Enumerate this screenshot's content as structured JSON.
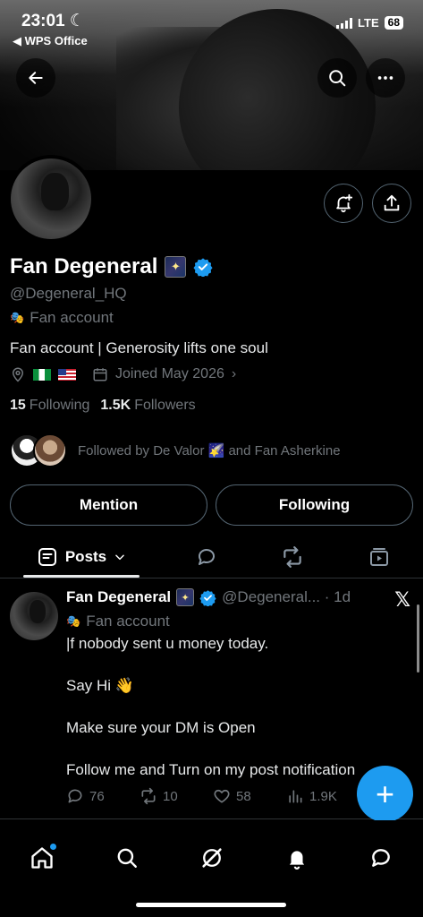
{
  "status": {
    "time": "23:01",
    "back_app": "◀ WPS Office",
    "network": "LTE",
    "battery": "68"
  },
  "profile": {
    "name": "Fan Degeneral",
    "handle": "@Degeneral_HQ",
    "label": "Fan account",
    "bio": "Fan account | Generosity lifts one soul",
    "joined": "Joined May 2026",
    "following_count": "15",
    "following_label": "Following",
    "followers_count": "1.5K",
    "followers_label": "Followers",
    "followed_by": "Followed by De Valor 🌠 and Fan Asherkine"
  },
  "buttons": {
    "mention": "Mention",
    "following": "Following"
  },
  "tabs": {
    "posts": "Posts"
  },
  "post": {
    "name": "Fan Degeneral",
    "handle_time": "@Degeneral... · 1d",
    "label": "Fan account",
    "lines": [
      "|f nobody sent u money today.",
      "Say Hi 👋",
      "Make sure your DM is Open",
      "Follow me and Turn on my post notification"
    ],
    "replies": "76",
    "reposts": "10",
    "likes": "58",
    "views": "1.9K"
  },
  "colors": {
    "accent": "#1d9bf0",
    "muted": "#71767b",
    "border": "#2f3336"
  }
}
